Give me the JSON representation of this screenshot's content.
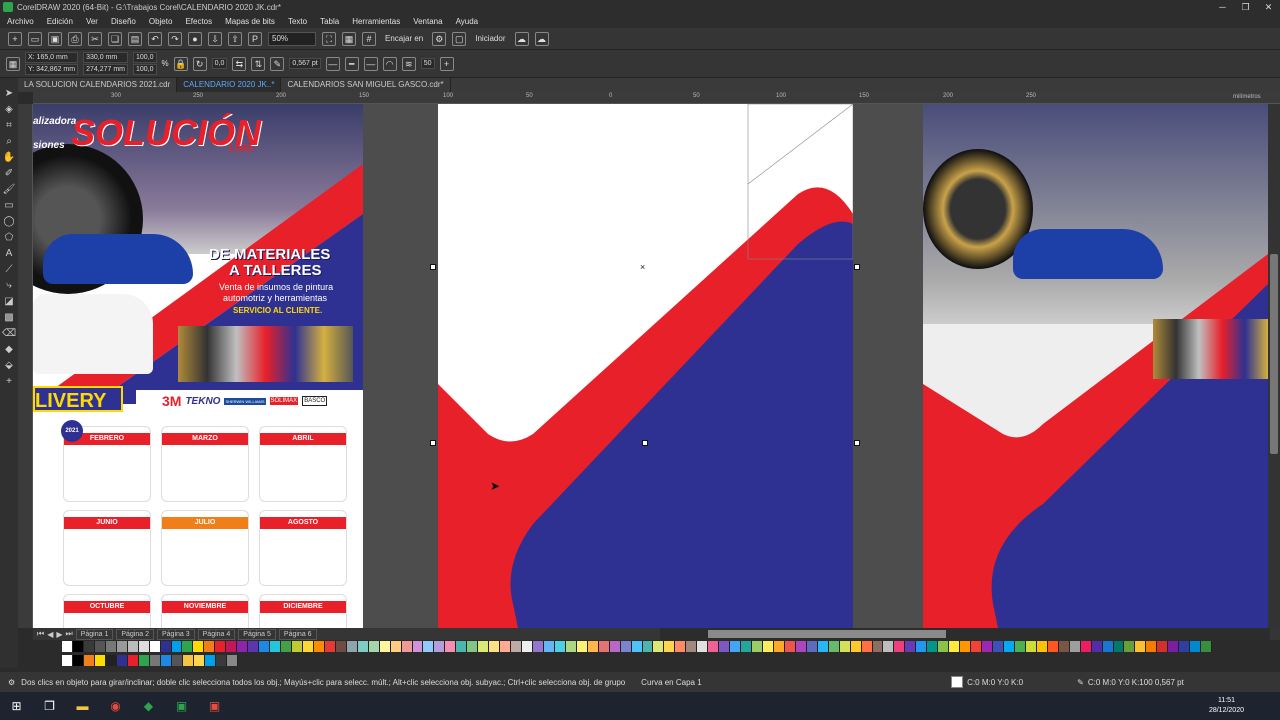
{
  "window": {
    "title": "CorelDRAW 2020 (64-Bit) - G:\\Trabajos Corel\\CALENDARIO 2020 JK.cdr*"
  },
  "menu": [
    "Archivo",
    "Edición",
    "Ver",
    "Diseño",
    "Objeto",
    "Efectos",
    "Mapas de bits",
    "Texto",
    "Tabla",
    "Herramientas",
    "Ventana",
    "Ayuda"
  ],
  "toolbar": {
    "zoom": "50%",
    "snap_label": "Encajar en",
    "launcher_label": "Iniciador"
  },
  "propbar": {
    "x": "X: 165,0 mm",
    "y": "Y: 342,862 mm",
    "w": "330,0 mm",
    "h": "274,277 mm",
    "sx": "100,0",
    "sy": "100,0",
    "pct": "%",
    "angle": "0,0",
    "outline": "0,567 pt",
    "smooth": "50"
  },
  "tabs": [
    "LA SOLUCION CALENDARIOS 2021.cdr",
    "CALENDARIO 2020 JK..*",
    "CALENDARIOS SAN MIGUEL GASCO.cdr*"
  ],
  "ruler": {
    "unit": "milímetros",
    "ticks": [
      "300",
      "250",
      "200",
      "150",
      "100",
      "50",
      "0",
      "50",
      "100",
      "150",
      "200",
      "250"
    ]
  },
  "pages": [
    "Página 1",
    "Página 2",
    "Página 3",
    "Página 4",
    "Página 5",
    "Página 6"
  ],
  "status": {
    "hint": "Dos clics en objeto para girar/inclinar; doble clic selecciona todos los obj.; Mayús+clic para selecc. múlt.; Alt+clic selecciona obj. subyac.; Ctrl+clic selecciona obj. de grupo",
    "object": "Curva en Capa 1",
    "fill": "C:0 M:0 Y:0 K:0",
    "outline": "C:0 M:0 Y:0 K:100  0,567 pt"
  },
  "clock": {
    "time": "11:51",
    "date": "28/12/2020"
  },
  "artwork": {
    "brand_prefix": "alizadora",
    "brand_prefix2": "siones",
    "brand": "SOLUCIÓN",
    "brand_suffix": "Ltda.",
    "headline1": "DE MATERIALES",
    "headline2": "A TALLERES",
    "subline1": "Venta de insumos de pintura",
    "subline2": "automotriz y herramientas",
    "service": "SERVICIO AL CLIENTE.",
    "delivery": "LIVERY",
    "logos": [
      "3M",
      "TEKNO",
      "SHERWIN WILLIAMS",
      "SOLIMAX",
      "BASCO"
    ],
    "year_badge": "2021",
    "months": [
      "FEBRERO",
      "MARZO",
      "ABRIL",
      "JUNIO",
      "JULIO",
      "AGOSTO",
      "OCTUBRE",
      "NOVIEMBRE",
      "DICIEMBRE"
    ]
  },
  "colors": {
    "red": "#e8202a",
    "blue": "#2e3192",
    "accent_tab": "#5fa8ff"
  }
}
